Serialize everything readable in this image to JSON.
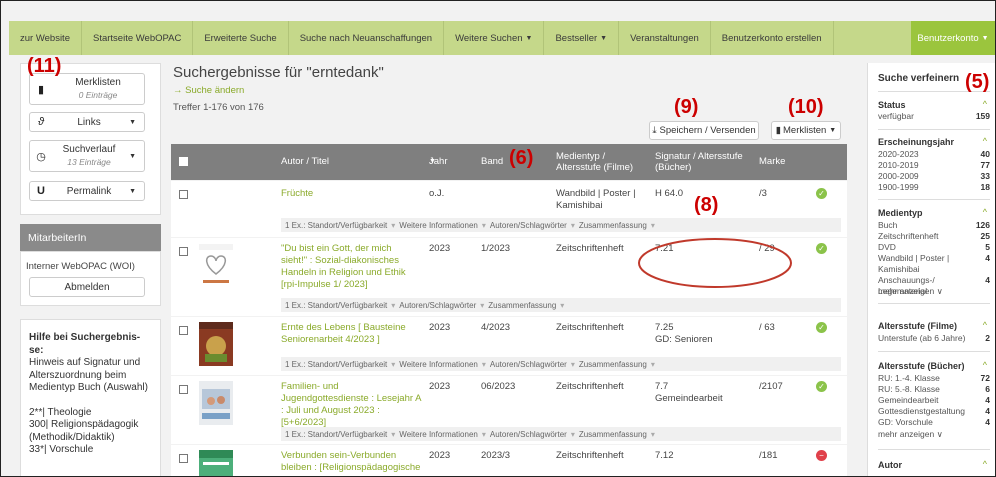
{
  "nav": {
    "items": [
      "zur Website",
      "Startseite WebOPAC",
      "Erweiterte Suche",
      "Suche nach Neuanschaffungen",
      "Weitere Suchen",
      "Bestseller",
      "Veranstaltungen",
      "Benutzerkonto erstellen"
    ],
    "account": "Benutzerkonto"
  },
  "annotations": {
    "a11": "(11)",
    "a9": "(9)",
    "a10": "(10)",
    "a6": "(6)",
    "a8": "(8)",
    "a5": "(5)"
  },
  "left": {
    "merklisten": {
      "label": "Merklisten",
      "sub": "0 Einträge"
    },
    "links": "Links",
    "suchverlauf": {
      "label": "Suchverlauf",
      "sub": "13 Einträge"
    },
    "permalink": "Permalink",
    "mitarbeiter_header": "MitarbeiterIn",
    "woi": "Interner WebOPAC (WOI)",
    "abmelden": "Abmelden",
    "help_title": "Hilfe bei Suchergebnis-se:",
    "help_text": "Hinweis auf Signatur und Alterszuordnung beim Medientyp Buch (Auswahl)",
    "help_line1": "2**| Theologie",
    "help_line2": "300| Religionspädagogik (Methodik/Didaktik)",
    "help_line3": "33*| Vorschule"
  },
  "main": {
    "title": "Suchergebnisse für \"erntedank\"",
    "change_search": "Suche ändern",
    "hits": "Treffer 1-176 von 176",
    "save_send": "Speichern / Versenden",
    "merklisten": "Merklisten"
  },
  "table": {
    "headers": {
      "author": "Autor / Titel",
      "year": "Jahr",
      "band": "Band",
      "medium": "Medientyp / Altersstufe (Filme)",
      "signatur": "Signatur / Altersstufe (Bücher)",
      "marke": "Marke"
    },
    "subbar": [
      "1 Ex.: Standort/Verfügbarkeit",
      "Weitere Informationen",
      "Autoren/Schlagwörter",
      "Zusammenfassung"
    ],
    "rows": [
      {
        "title": "Früchte",
        "year": "o.J.",
        "band": "",
        "medium": "Wandbild | Poster | Kamishibai",
        "signatur": "H 64.0",
        "marke": "/3",
        "status": "ok"
      },
      {
        "title": "\"Du bist ein Gott, der mich sieht!\" : Sozial-diakonisches Handeln in Religion und Ethik [rpi-Impulse 1/ 2023]",
        "year": "2023",
        "band": "1/2023",
        "medium": "Zeitschriftenheft",
        "signatur": "7.21",
        "marke": "/ 29",
        "status": "ok"
      },
      {
        "title": "Ernte des Lebens [ Bausteine Seniorenarbeit 4/2023 ]",
        "year": "2023",
        "band": "4/2023",
        "medium": "Zeitschriftenheft",
        "signatur": "7.25",
        "signatur2": "GD: Senioren",
        "marke": "/ 63",
        "status": "ok"
      },
      {
        "title": "Familien- und Jugendgottesdienste : Lesejahr A : Juli und August 2023 : [5+6/2023]",
        "year": "2023",
        "band": "06/2023",
        "medium": "Zeitschriftenheft",
        "signatur": "7.7",
        "signatur2": "Gemeindearbeit",
        "marke": "/2107",
        "status": "ok"
      },
      {
        "title": "Verbunden sein-Verbunden bleiben : [Religionspädagogische",
        "year": "2023",
        "band": "2023/3",
        "medium": "Zeitschriftenheft",
        "signatur": "7.12",
        "marke": "/181",
        "status": "no"
      }
    ]
  },
  "refine": {
    "title": "Suche verfeinern",
    "status": {
      "label": "Status",
      "rows": [
        [
          "verfügbar",
          "159"
        ]
      ]
    },
    "erscheinung": {
      "label": "Erscheinungsjahr",
      "rows": [
        [
          "2020-2023",
          "40"
        ],
        [
          "2010-2019",
          "77"
        ],
        [
          "2000-2009",
          "33"
        ],
        [
          "1900-1999",
          "18"
        ]
      ]
    },
    "medientyp": {
      "label": "Medientyp",
      "rows": [
        [
          "Buch",
          "126"
        ],
        [
          "Zeitschriftenheft",
          "25"
        ],
        [
          "DVD",
          "5"
        ],
        [
          "Wandbild | Poster | Kamishibai",
          "4"
        ],
        [
          "Anschauungs-/ Legematerial",
          "4"
        ]
      ],
      "more": "mehr anzeigen"
    },
    "filme": {
      "label": "Altersstufe (Filme)",
      "rows": [
        [
          "Unterstufe (ab 6 Jahre)",
          "2"
        ]
      ]
    },
    "buecher": {
      "label": "Altersstufe (Bücher)",
      "rows": [
        [
          "RU: 1.-4. Klasse",
          "72"
        ],
        [
          "RU: 5.-8. Klasse",
          "6"
        ],
        [
          "Gemeindearbeit",
          "4"
        ],
        [
          "Gottesdienstgestaltung",
          "4"
        ],
        [
          "GD: Vorschule",
          "4"
        ]
      ],
      "more": "mehr anzeigen"
    },
    "autor": {
      "label": "Autor"
    }
  },
  "colors": {
    "nav": "#c5d88a",
    "accent": "#9bc53d",
    "link": "#8aaa2a",
    "header": "#7f7f7f",
    "annotation": "#cc0000"
  }
}
